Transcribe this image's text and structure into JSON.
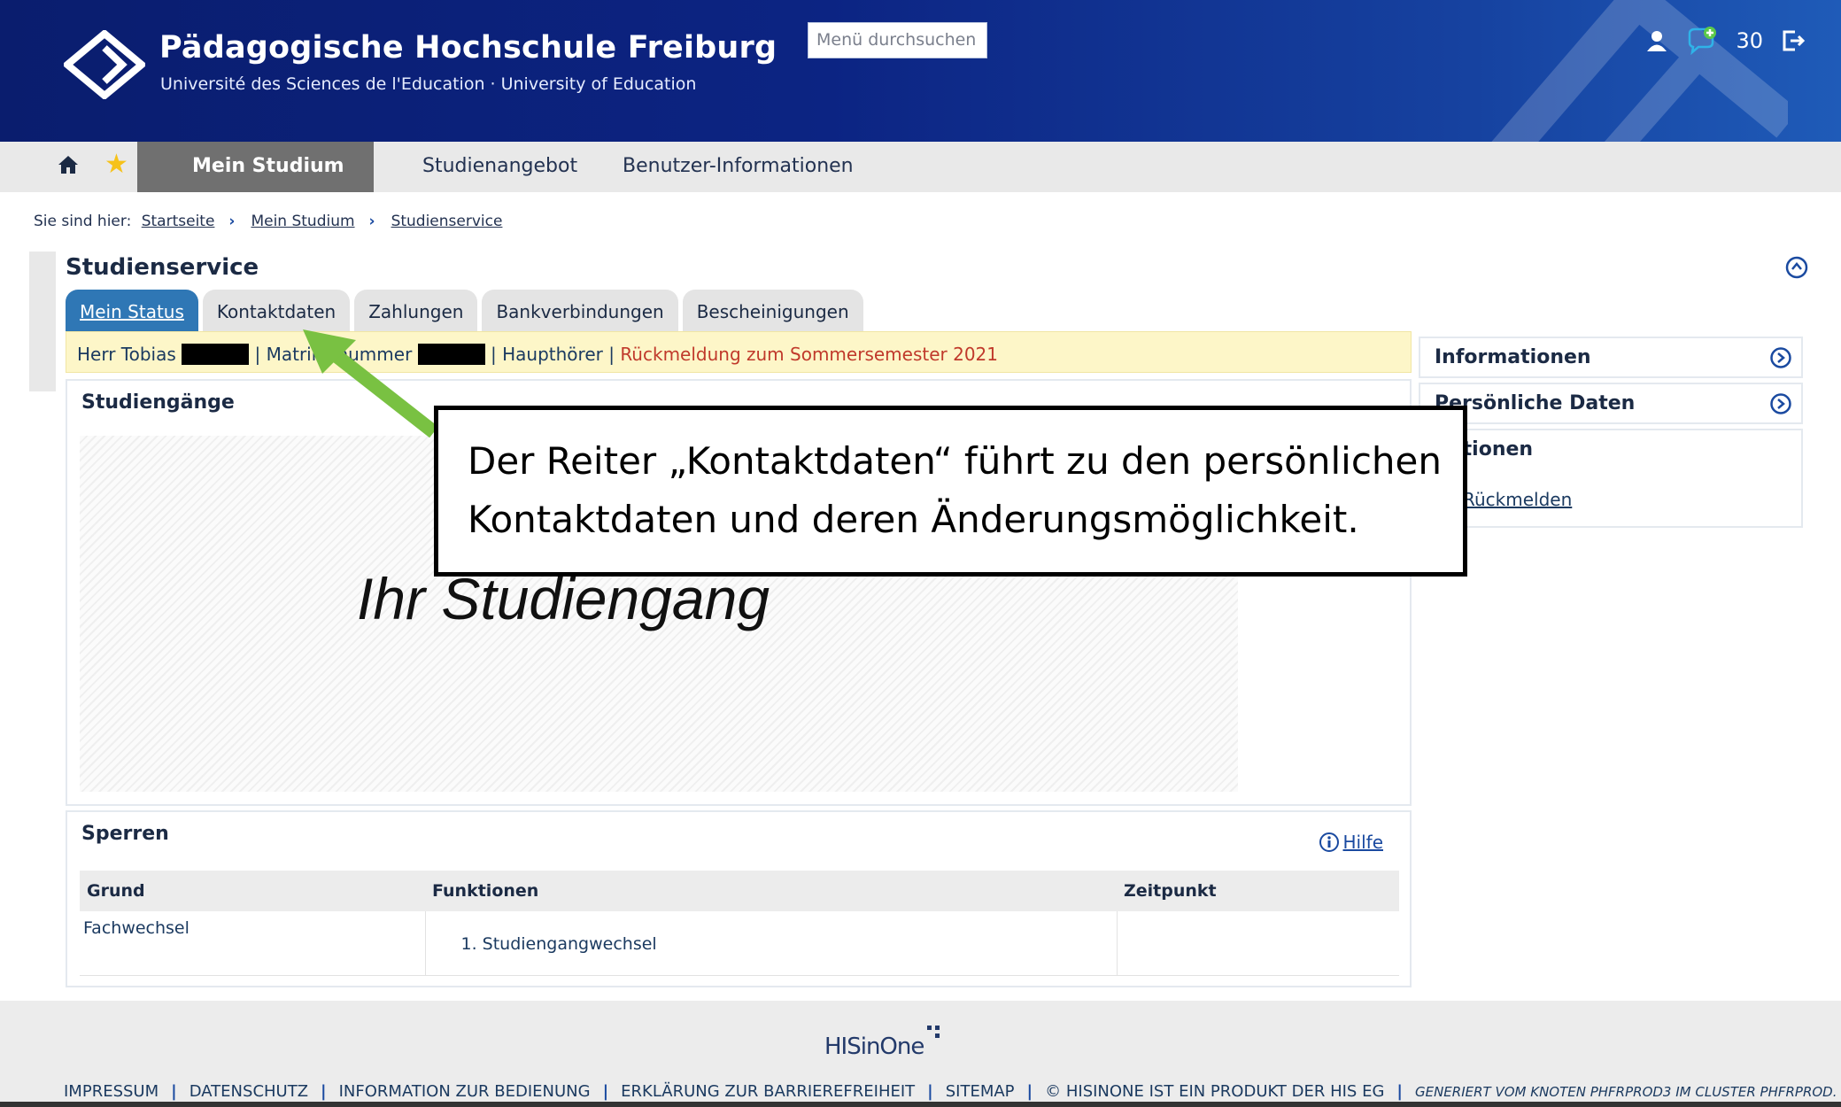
{
  "header": {
    "title": "Pädagogische Hochschule Freiburg",
    "subtitle": "Université des Sciences de l'Education · University of Education",
    "search_placeholder": "Menü durchsuchen",
    "message_count": "30"
  },
  "nav": {
    "items": [
      "Mein Studium",
      "Studienangebot",
      "Benutzer-Informationen"
    ]
  },
  "breadcrumb": {
    "label": "Sie sind hier:",
    "items": [
      "Startseite",
      "Mein Studium",
      "Studienservice"
    ]
  },
  "page": {
    "title": "Studienservice",
    "tabs": [
      "Mein Status",
      "Kontaktdaten",
      "Zahlungen",
      "Bankverbindungen",
      "Bescheinigungen"
    ]
  },
  "status": {
    "name": "Herr Tobias",
    "matrikel_label": "| Matrikelnummer",
    "role": "| Haupthörer |",
    "notice": "Rückmeldung zum Sommersemester 2021"
  },
  "studiengaenge": {
    "title": "Studiengänge",
    "placeholder": "Ihr Studiengang"
  },
  "sperren": {
    "title": "Sperren",
    "help": "Hilfe",
    "columns": [
      "Grund",
      "Funktionen",
      "Zeitpunkt"
    ],
    "rows": [
      [
        "Fachwechsel",
        "1. Studiengangwechsel",
        ""
      ]
    ]
  },
  "sidebar": {
    "informationen": "Informationen",
    "persoenliche_daten": "Persönliche Daten",
    "aktionen": "Aktionen",
    "rueckmelden": "Rückmelden"
  },
  "callout": {
    "line1": "Der Reiter „Kontaktdaten“ führt zu den persönlichen",
    "line2": "Kontaktdaten und deren Änderungsmöglichkeit."
  },
  "footer": {
    "logo": "HISinOne",
    "links": [
      "IMPRESSUM",
      "DATENSCHUTZ",
      "INFORMATION ZUR BEDIENUNG",
      "ERKLÄRUNG ZUR BARRIEREFREIHEIT",
      "SITEMAP",
      "© HISINONE IST EIN PRODUKT DER HIS EG"
    ],
    "generated": "GENERIERT VOM KNOTEN PHFRPROD3 IM CLUSTER PHFRPROD."
  },
  "colors": {
    "header_blue": "#0c2483",
    "tab_active": "#2f77b5",
    "notice_red": "#c0392b",
    "arrow_green": "#79c142"
  }
}
